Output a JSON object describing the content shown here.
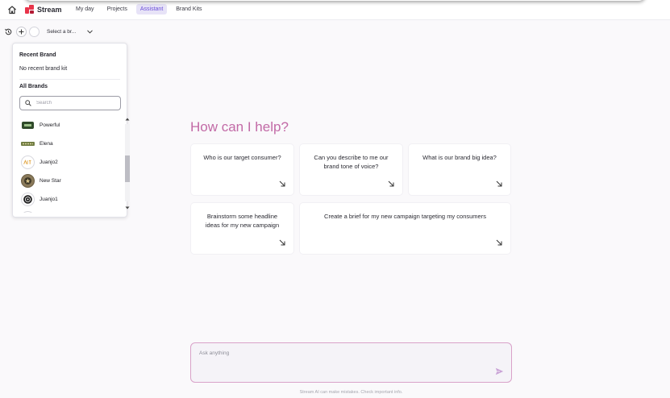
{
  "header": {
    "app_name": "Stream",
    "nav": [
      {
        "label": "My day",
        "active": false
      },
      {
        "label": "Projects",
        "active": false
      },
      {
        "label": "Assistant",
        "active": true
      },
      {
        "label": "Brand Kits",
        "active": false
      }
    ],
    "icons": [
      "home-icon",
      "stream-logo-icon"
    ]
  },
  "toolbar": {
    "brand_select_value": "Select a br...",
    "icons": [
      "history-icon",
      "plus-icon",
      "chevron-down-icon"
    ]
  },
  "brand_dropdown": {
    "recent_heading": "Recent Brand",
    "recent_empty_text": "No recent brand kit",
    "all_heading": "All Brands",
    "search_placeholder": "Search",
    "brands": [
      {
        "name": "Powerful"
      },
      {
        "name": "Elena"
      },
      {
        "name": "Juanjo2"
      },
      {
        "name": "New Star"
      },
      {
        "name": "Juanjo1"
      }
    ]
  },
  "main": {
    "title": "How can I help?",
    "suggestions": [
      "Who is our target consumer?",
      "Can you describe to me our brand tone of voice?",
      "What is our brand big idea?",
      "Brainstorm some headline ideas for my new campaign",
      "Create a brief for my new campaign targeting my consumers"
    ]
  },
  "composer": {
    "placeholder": "Ask anything",
    "disclaimer": "Stream AI can make mistakes. Check important info."
  },
  "colors": {
    "accent": "#6b4fd8",
    "title": "#c26aa6",
    "composer_border": "#d9a2c9",
    "logo": "#e8344a"
  }
}
